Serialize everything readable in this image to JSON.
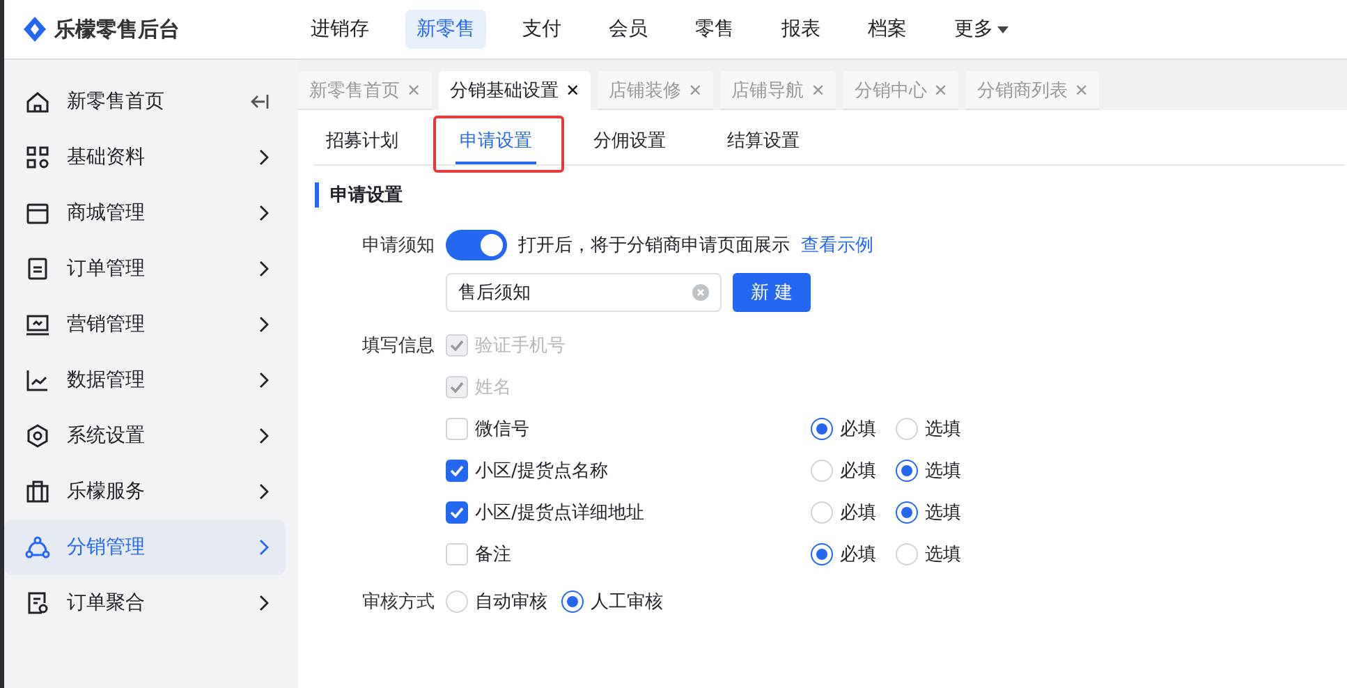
{
  "brand": {
    "name": "乐檬零售后台"
  },
  "top_nav": [
    {
      "label": "进销存",
      "selected": false,
      "kind": "link"
    },
    {
      "label": "新零售",
      "selected": true,
      "kind": "link"
    },
    {
      "label": "支付",
      "selected": false,
      "kind": "link"
    },
    {
      "label": "会员",
      "selected": false,
      "kind": "link"
    },
    {
      "label": "零售",
      "selected": false,
      "kind": "link"
    },
    {
      "label": "报表",
      "selected": false,
      "kind": "link"
    },
    {
      "label": "档案",
      "selected": false,
      "kind": "link"
    },
    {
      "label": "更多",
      "selected": false,
      "kind": "dropdown"
    }
  ],
  "sidebar": {
    "items": [
      {
        "label": "新零售首页",
        "selected": false
      },
      {
        "label": "基础资料",
        "selected": false
      },
      {
        "label": "商城管理",
        "selected": false
      },
      {
        "label": "订单管理",
        "selected": false
      },
      {
        "label": "营销管理",
        "selected": false
      },
      {
        "label": "数据管理",
        "selected": false
      },
      {
        "label": "系统设置",
        "selected": false
      },
      {
        "label": "乐檬服务",
        "selected": false
      },
      {
        "label": "分销管理",
        "selected": true
      },
      {
        "label": "订单聚合",
        "selected": false
      }
    ]
  },
  "page_tabs": [
    {
      "label": "新零售首页",
      "selected": false,
      "close": "✕"
    },
    {
      "label": "分销基础设置",
      "selected": true,
      "close": "✕"
    },
    {
      "label": "店铺装修",
      "selected": false,
      "close": "✕"
    },
    {
      "label": "店铺导航",
      "selected": false,
      "close": "✕"
    },
    {
      "label": "分销中心",
      "selected": false,
      "close": "✕"
    },
    {
      "label": "分销商列表",
      "selected": false,
      "close": "✕"
    }
  ],
  "sub_tabs": [
    {
      "label": "招募计划",
      "selected": false,
      "highlighted": false
    },
    {
      "label": "申请设置",
      "selected": true,
      "highlighted": true
    },
    {
      "label": "分佣设置",
      "selected": false,
      "highlighted": false
    },
    {
      "label": "结算设置",
      "selected": false,
      "highlighted": false
    }
  ],
  "section": {
    "title": "申请设置",
    "notice": {
      "label": "申请须知",
      "on": true,
      "hint": "打开后，将于分销商申请页面展示",
      "link": "查看示例",
      "select_value": "售后须知",
      "button": "新 建"
    },
    "fields": {
      "label": "填写信息",
      "items": [
        {
          "label": "验证手机号",
          "checked": true,
          "disabled": true
        },
        {
          "label": "姓名",
          "checked": true,
          "disabled": true
        },
        {
          "label": "微信号",
          "checked": false,
          "disabled": false,
          "options": [
            {
              "label": "必填",
              "selected": true
            },
            {
              "label": "选填",
              "selected": false
            }
          ]
        },
        {
          "label": "小区/提货点名称",
          "checked": true,
          "disabled": false,
          "options": [
            {
              "label": "必填",
              "selected": false
            },
            {
              "label": "选填",
              "selected": true
            }
          ]
        },
        {
          "label": "小区/提货点详细地址",
          "checked": true,
          "disabled": false,
          "options": [
            {
              "label": "必填",
              "selected": false
            },
            {
              "label": "选填",
              "selected": true
            }
          ]
        },
        {
          "label": "备注",
          "checked": false,
          "disabled": false,
          "options": [
            {
              "label": "必填",
              "selected": true
            },
            {
              "label": "选填",
              "selected": false
            }
          ]
        }
      ]
    },
    "review": {
      "label": "审核方式",
      "options": [
        {
          "label": "自动审核",
          "selected": false
        },
        {
          "label": "人工审核",
          "selected": true
        }
      ]
    }
  }
}
